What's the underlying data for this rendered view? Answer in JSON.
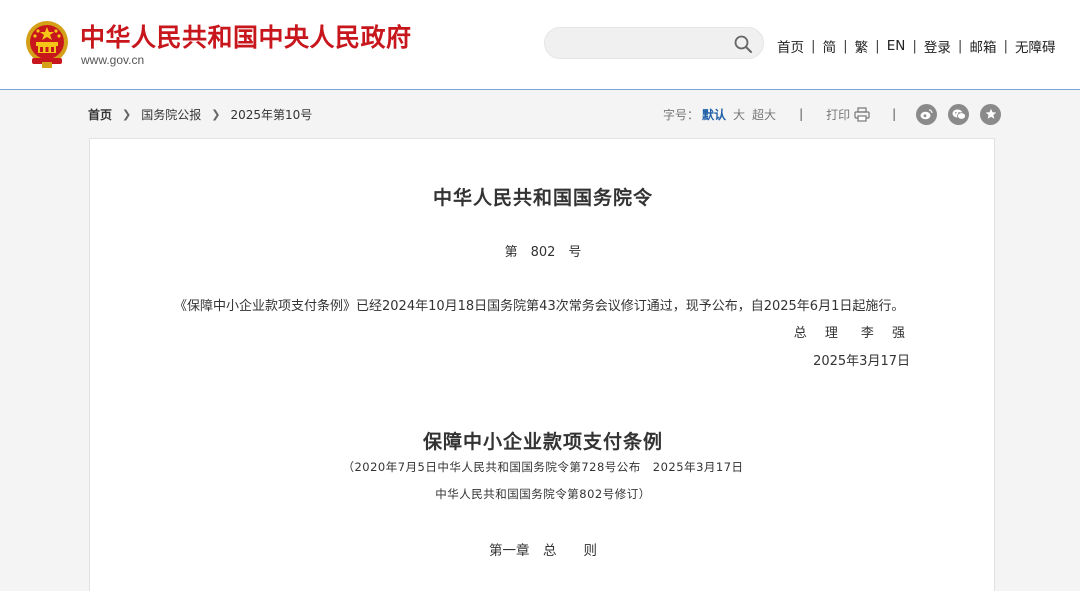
{
  "header": {
    "site_title": "中华人民共和国中央人民政府",
    "site_url": "www.gov.cn",
    "search": {
      "value": "",
      "placeholder": ""
    },
    "nav": [
      "首页",
      "简",
      "繁",
      "EN",
      "登录",
      "邮箱",
      "无障碍"
    ],
    "colors": {
      "brand_red": "#c8161d",
      "link_blue": "#1f5fa8"
    }
  },
  "breadcrumb": {
    "items": [
      "首页",
      "国务院公报",
      "2025年第10号"
    ]
  },
  "tools": {
    "font_size_label": "字号：",
    "font_sizes": [
      "默认",
      "大",
      "超大"
    ],
    "active_font_size": "默认",
    "separator": "|",
    "print_label": "打印",
    "share_icons": [
      "weibo-icon",
      "wechat-icon",
      "favorite-icon"
    ]
  },
  "article": {
    "title": "中华人民共和国国务院令",
    "order_number": "第　802　号",
    "body": "《保障中小企业款项支付条例》已经2024年10月18日国务院第43次常务会议修订通过，现予公布，自2025年6月1日起施行。",
    "signer": "总 理　李 强",
    "date": "2025年3月17日",
    "regulation_title": "保障中小企业款项支付条例",
    "note_line1": "（2020年7月5日中华人民共和国国务院令第728号公布　2025年3月17日",
    "note_line2": "中华人民共和国国务院令第802号修订）",
    "chapter": "第一章　总　　则"
  }
}
